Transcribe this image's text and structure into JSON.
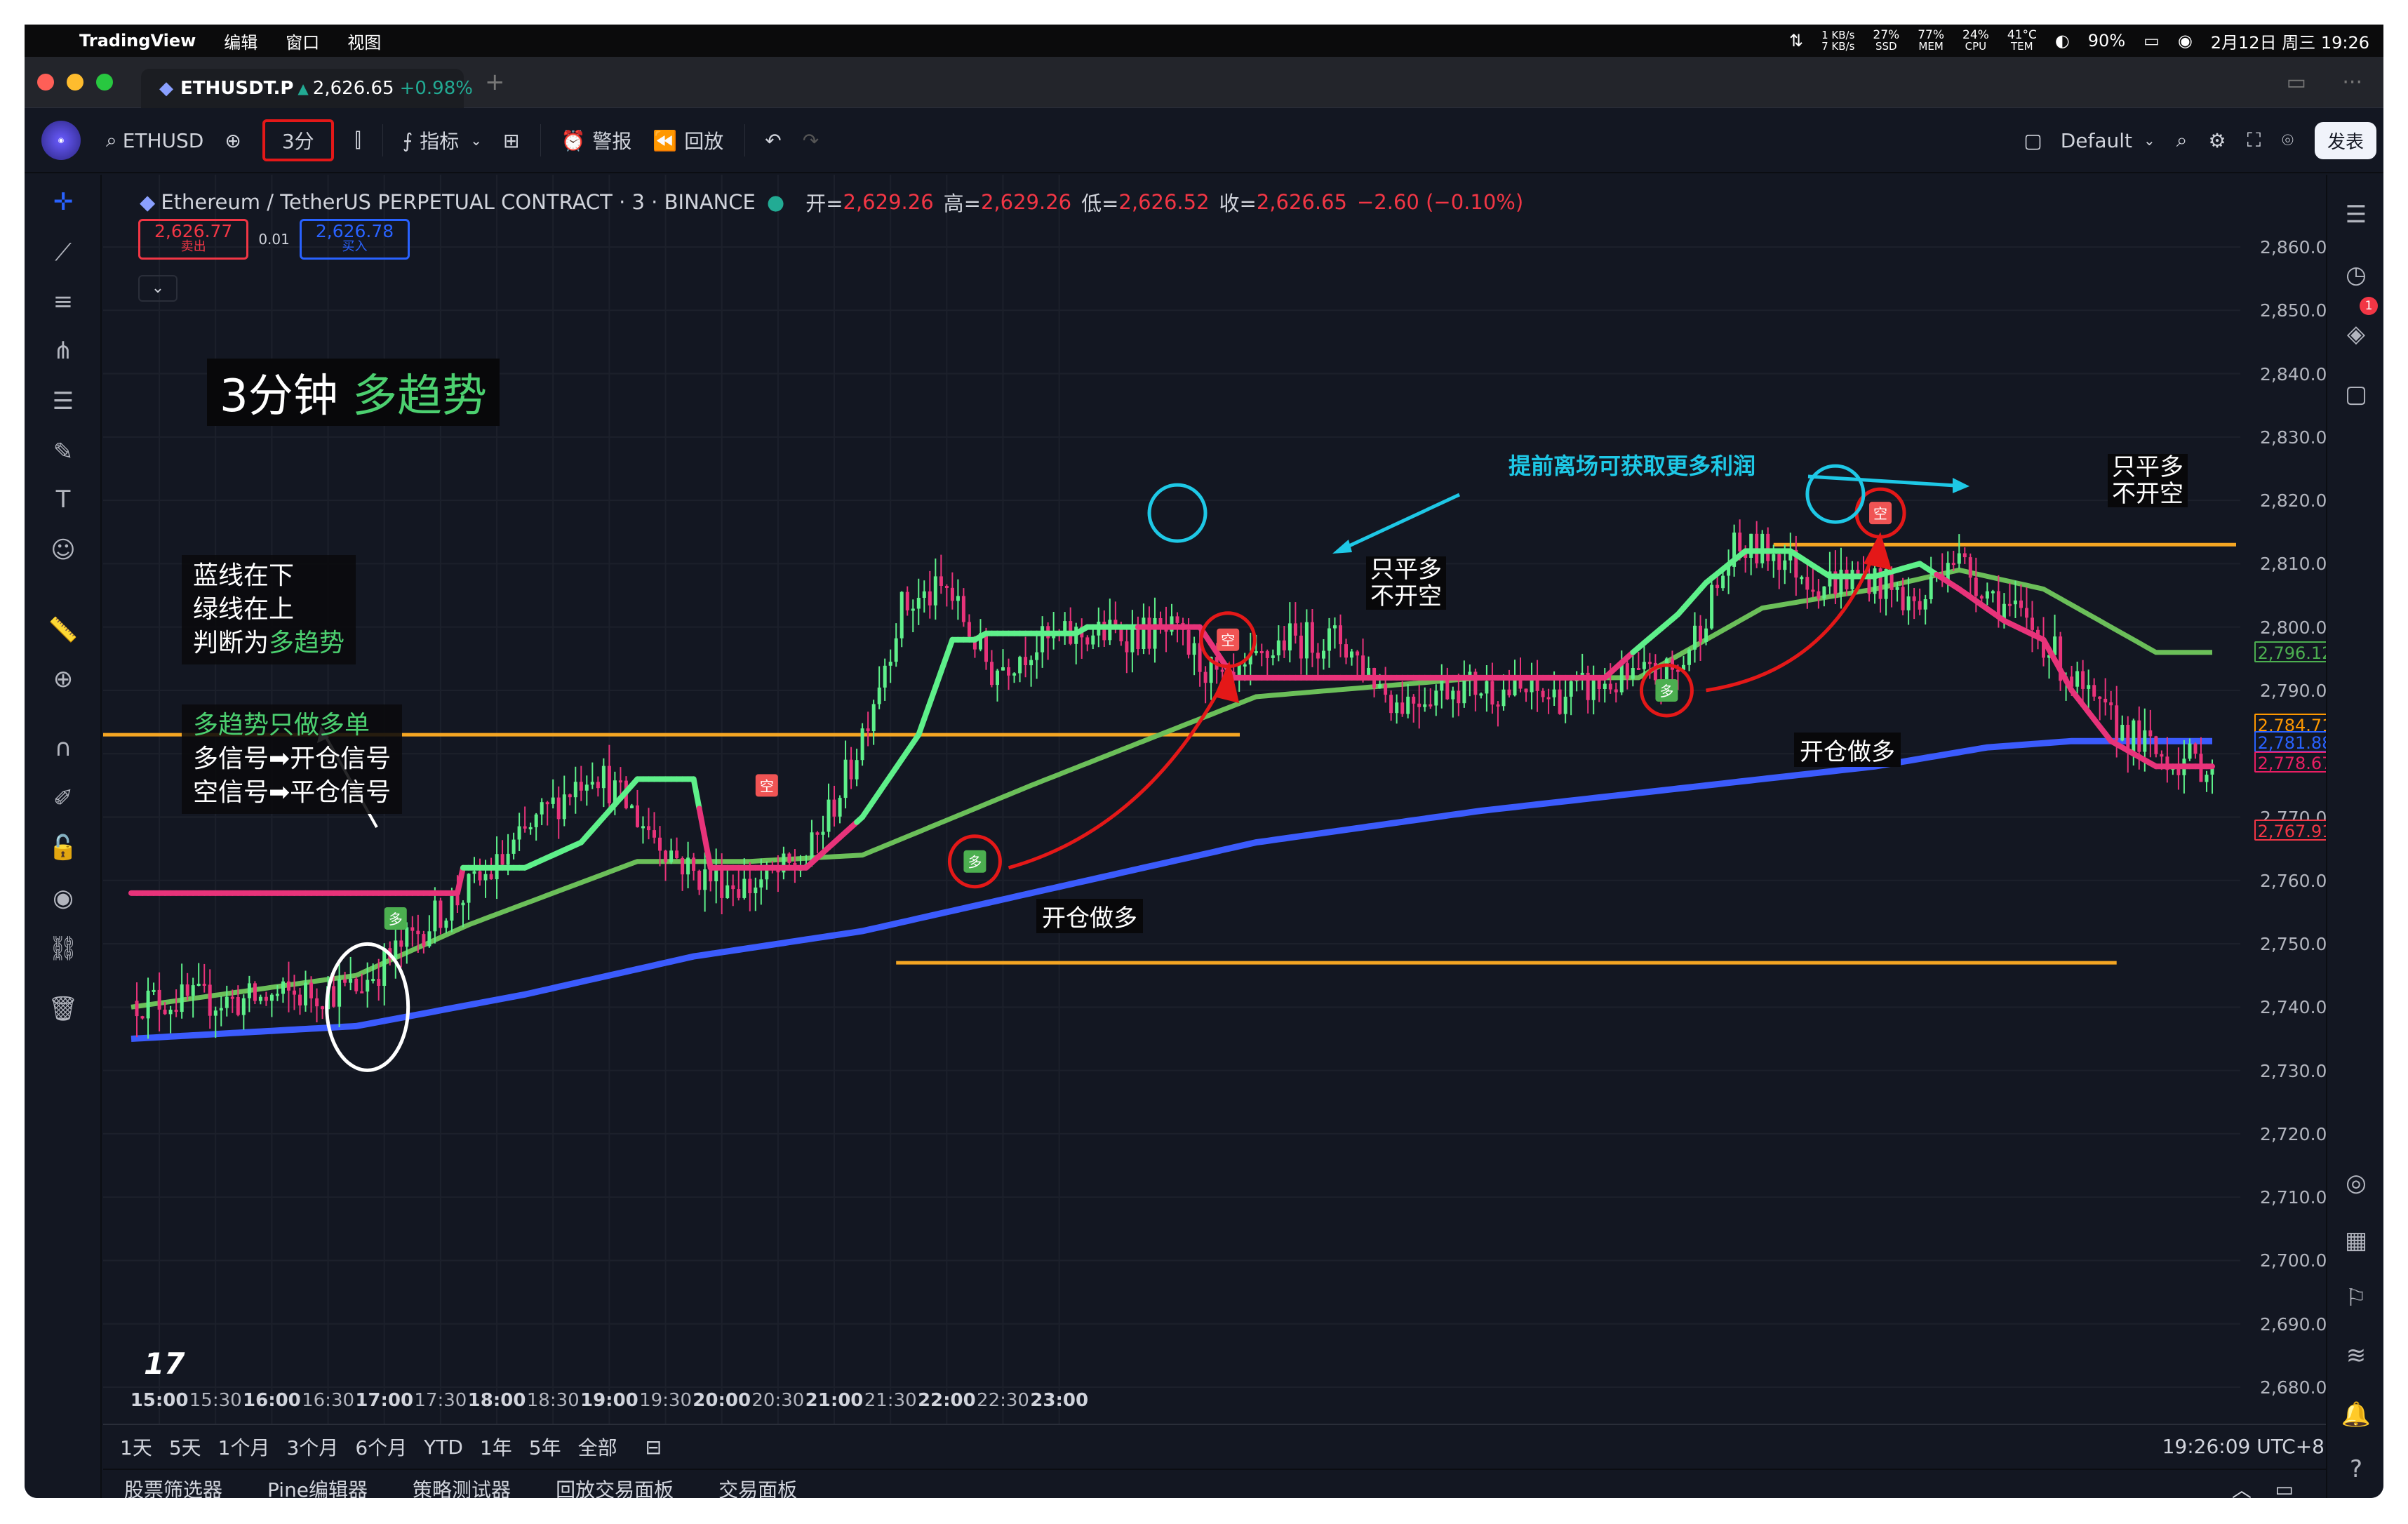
{
  "menubar": {
    "app": "TradingView",
    "items": [
      "编辑",
      "窗口",
      "视图"
    ],
    "net_up": "1 KB/s",
    "net_down": "7 KB/s",
    "ssd_val": "27%",
    "ssd_lbl": "SSD",
    "mem_val": "77%",
    "mem_lbl": "MEM",
    "cpu_val": "24%",
    "cpu_lbl": "CPU",
    "tem_val": "41°C",
    "tem_lbl": "TEM",
    "battery": "90%",
    "datetime": "2月12日 周三  19:26"
  },
  "tab": {
    "symbol": "ETHUSDT.P",
    "price": "2,626.65",
    "change": "+0.98%"
  },
  "toolbar": {
    "symbol": "ETHUSD",
    "interval": "3分",
    "indicators": "指标",
    "alert": "警报",
    "replay": "回放",
    "layout": "Default",
    "publish": "发表"
  },
  "legend": {
    "name": "Ethereum / TetherUS PERPETUAL CONTRACT · 3 · BINANCE",
    "open_lbl": "开=",
    "open": "2,629.26",
    "high_lbl": "高=",
    "high": "2,629.26",
    "low_lbl": "低=",
    "low": "2,626.52",
    "close_lbl": "收=",
    "close": "2,626.65",
    "change": "−2.60 (−0.10%)"
  },
  "order": {
    "sell_price": "2,626.77",
    "sell_lbl": "卖出",
    "qty": "0.01",
    "buy_price": "2,626.78",
    "buy_lbl": "买入"
  },
  "annotations": {
    "title_a": "3分钟",
    "title_b": "多趋势",
    "box1_l1": "蓝线在下",
    "box1_l2": "绿线在上",
    "box1_l3a": "判断为",
    "box1_l3b": "多趋势",
    "box2_l1": "多趋势只做多单",
    "box2_l2": "多信号➡开仓信号",
    "box2_l3": "空信号➡平仓信号",
    "tip": "提前离场可获取更多利润",
    "close_a1": "只平多",
    "close_a2": "不开空",
    "close_b1": "只平多",
    "close_b2": "不开空",
    "open_a": "开仓做多",
    "open_b": "开仓做多",
    "sig_long": "多",
    "sig_short": "空"
  },
  "yaxis": {
    "labels": [
      "2,860.00",
      "2,850.00",
      "2,840.00",
      "2,830.00",
      "2,820.00",
      "2,810.00",
      "2,800.00",
      "2,790.00",
      "2,780.00",
      "2,770.00",
      "2,760.00",
      "2,750.00",
      "2,740.00",
      "2,730.00",
      "2,720.00",
      "2,710.00",
      "2,700.00",
      "2,690.00",
      "2,680.00"
    ],
    "tags": [
      {
        "text": "2,796.12",
        "color": "#4caf50",
        "val": 2796.12
      },
      {
        "text": "2,784.71",
        "color": "#ff9800",
        "val": 2784.71
      },
      {
        "text": "2,781.88",
        "color": "#2962ff",
        "val": 2781.88
      },
      {
        "text": "2,778.67",
        "color": "#e91e63",
        "val": 2778.67
      },
      {
        "text": "2,767.91",
        "color": "#f23645",
        "val": 2767.91
      }
    ]
  },
  "xaxis": {
    "labels": [
      "15:00",
      "15:30",
      "16:00",
      "16:30",
      "17:00",
      "17:30",
      "18:00",
      "18:30",
      "19:00",
      "19:30",
      "20:00",
      "20:30",
      "21:00",
      "21:30",
      "22:00",
      "22:30",
      "23:00"
    ]
  },
  "ranges": {
    "items": [
      "1天",
      "5天",
      "1个月",
      "3个月",
      "6个月",
      "YTD",
      "1年",
      "5年",
      "全部"
    ],
    "time": "19:26:09 UTC+8"
  },
  "bottombar": {
    "items": [
      "股票筛选器",
      "Pine编辑器",
      "策略测试器",
      "回放交易面板",
      "交易面板"
    ]
  },
  "colors": {
    "up": "#5ef08a",
    "down": "#e8337a",
    "blue_ma": "#3b5bfd",
    "green_ma": "#6bbf59",
    "orange": "#f5a623",
    "cyan": "#1ec8e6",
    "red_mark": "#e41818"
  },
  "chart_data": {
    "type": "candlestick",
    "ylim": [
      2677,
      2862
    ],
    "price_step": 10,
    "time_start": "14:45",
    "time_end": "23:15",
    "interval": "3分",
    "resistance_high": 2813,
    "resistance_mid": 2783,
    "support_low": 2747,
    "price_path": [
      [
        0,
        2741
      ],
      [
        20,
        2741
      ],
      [
        40,
        2743
      ],
      [
        55,
        2755
      ],
      [
        65,
        2762
      ],
      [
        73,
        2770
      ],
      [
        82,
        2778
      ],
      [
        90,
        2770
      ],
      [
        100,
        2761
      ],
      [
        110,
        2759
      ],
      [
        120,
        2763
      ],
      [
        128,
        2778
      ],
      [
        137,
        2803
      ],
      [
        145,
        2806
      ],
      [
        153,
        2793
      ],
      [
        160,
        2797
      ],
      [
        170,
        2799
      ],
      [
        178,
        2799
      ],
      [
        185,
        2799
      ],
      [
        195,
        2790
      ],
      [
        205,
        2798
      ],
      [
        215,
        2798
      ],
      [
        225,
        2788
      ],
      [
        235,
        2791
      ],
      [
        245,
        2790
      ],
      [
        253,
        2789
      ],
      [
        262,
        2791
      ],
      [
        275,
        2793
      ],
      [
        285,
        2812
      ],
      [
        292,
        2812
      ],
      [
        300,
        2807
      ],
      [
        309,
        2808
      ],
      [
        318,
        2803
      ],
      [
        323,
        2812
      ],
      [
        331,
        2805
      ],
      [
        340,
        2798
      ],
      [
        349,
        2787
      ],
      [
        360,
        2780
      ],
      [
        370,
        2778
      ]
    ],
    "fast_line": [
      [
        0,
        2758
      ],
      [
        10,
        2758
      ],
      [
        20,
        2758
      ],
      [
        30,
        2758
      ],
      [
        40,
        2758
      ],
      [
        50,
        2758
      ],
      [
        58,
        2758
      ],
      [
        59,
        2762
      ],
      [
        70,
        2762
      ],
      [
        80,
        2766
      ],
      [
        90,
        2776
      ],
      [
        100,
        2776
      ],
      [
        103,
        2762
      ],
      [
        110,
        2762
      ],
      [
        120,
        2762
      ],
      [
        130,
        2770
      ],
      [
        140,
        2783
      ],
      [
        146,
        2798
      ],
      [
        150,
        2798
      ],
      [
        152,
        2799
      ],
      [
        160,
        2799
      ],
      [
        168,
        2799
      ],
      [
        170,
        2800
      ],
      [
        182,
        2800
      ],
      [
        190,
        2800
      ],
      [
        196,
        2792
      ],
      [
        210,
        2792
      ],
      [
        220,
        2792
      ],
      [
        230,
        2792
      ],
      [
        240,
        2792
      ],
      [
        250,
        2792
      ],
      [
        262,
        2792
      ],
      [
        267,
        2796
      ],
      [
        275,
        2802
      ],
      [
        280,
        2807
      ],
      [
        287,
        2812
      ],
      [
        295,
        2812
      ],
      [
        302,
        2808
      ],
      [
        310,
        2808
      ],
      [
        318,
        2810
      ],
      [
        325,
        2806
      ],
      [
        333,
        2801
      ],
      [
        340,
        2798
      ],
      [
        345,
        2790
      ],
      [
        352,
        2782
      ],
      [
        360,
        2778
      ],
      [
        370,
        2778
      ]
    ],
    "fast_up_ranges": [
      [
        59,
        100
      ],
      [
        129,
        178
      ],
      [
        267,
        320
      ]
    ],
    "green_ma": [
      [
        0,
        2740
      ],
      [
        40,
        2745
      ],
      [
        60,
        2753
      ],
      [
        90,
        2763
      ],
      [
        110,
        2763
      ],
      [
        130,
        2764
      ],
      [
        160,
        2775
      ],
      [
        200,
        2789
      ],
      [
        240,
        2792
      ],
      [
        268,
        2792
      ],
      [
        290,
        2803
      ],
      [
        310,
        2806
      ],
      [
        325,
        2809
      ],
      [
        340,
        2806
      ],
      [
        360,
        2796
      ],
      [
        370,
        2796
      ]
    ],
    "blue_ma": [
      [
        0,
        2735
      ],
      [
        40,
        2737
      ],
      [
        70,
        2742
      ],
      [
        100,
        2748
      ],
      [
        130,
        2752
      ],
      [
        160,
        2758
      ],
      [
        200,
        2766
      ],
      [
        240,
        2771
      ],
      [
        280,
        2775
      ],
      [
        310,
        2778
      ],
      [
        330,
        2781
      ],
      [
        345,
        2782
      ],
      [
        360,
        2782
      ],
      [
        370,
        2782
      ]
    ],
    "signals": [
      {
        "label": "多",
        "kind": "long",
        "idx": 47,
        "price": 2754
      },
      {
        "label": "空",
        "kind": "short",
        "idx": 113,
        "price": 2775
      },
      {
        "label": "多",
        "kind": "long",
        "idx": 150,
        "price": 2763
      },
      {
        "label": "空",
        "kind": "short",
        "idx": 195,
        "price": 2798
      },
      {
        "label": "多",
        "kind": "long",
        "idx": 273,
        "price": 2790
      },
      {
        "label": "空",
        "kind": "short",
        "idx": 311,
        "price": 2818
      }
    ]
  }
}
